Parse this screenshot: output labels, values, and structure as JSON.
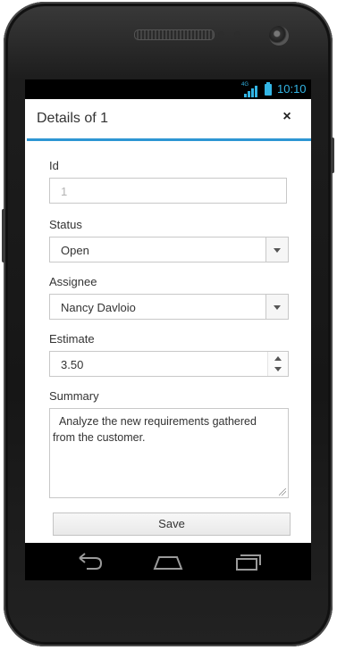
{
  "status_bar": {
    "network": "4G",
    "time": "10:10"
  },
  "dialog": {
    "title": "Details of 1",
    "close_glyph": "×"
  },
  "form": {
    "id": {
      "label": "Id",
      "value": "1"
    },
    "status": {
      "label": "Status",
      "value": "Open"
    },
    "assignee": {
      "label": "Assignee",
      "value": "Nancy Davloio"
    },
    "estimate": {
      "label": "Estimate",
      "value": "3.50"
    },
    "summary": {
      "label": "Summary",
      "value": "  Analyze the new requirements gathered from the customer."
    },
    "save_label": "Save"
  },
  "nav": {
    "back_icon": "back-arrow",
    "home_icon": "home",
    "recents_icon": "recent-apps"
  },
  "colors": {
    "accent": "#2d96d3",
    "status_icons": "#33b5e5"
  }
}
